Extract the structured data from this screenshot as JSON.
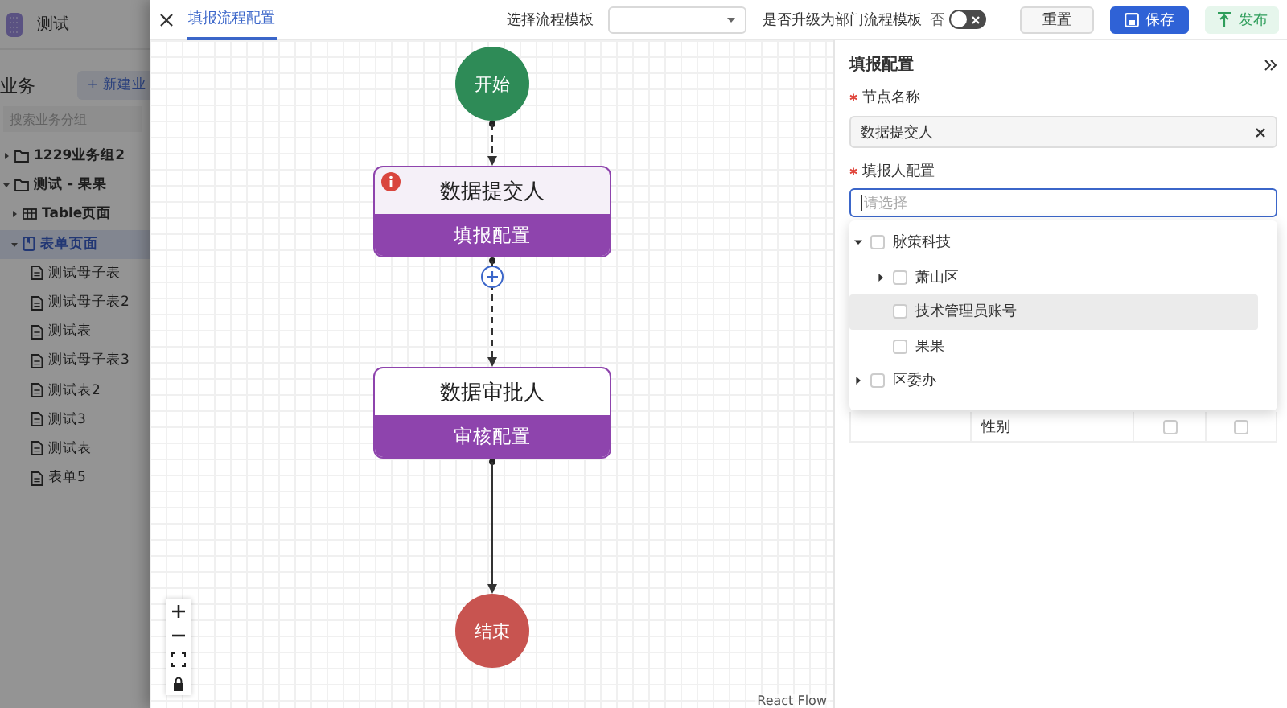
{
  "sidebar": {
    "app_name": "测试",
    "section_title": "业务",
    "new_button": "+ 新建业",
    "search": {
      "placeholder": "搜索业务分组"
    },
    "tree": [
      {
        "label": "1229业务组2",
        "kind": "folder",
        "expanded": false,
        "selected": false
      },
      {
        "label": "测试 - 果果",
        "kind": "folder",
        "expanded": true,
        "selected": false,
        "children": [
          {
            "label": "Table页面",
            "kind": "table",
            "expanded": false,
            "selected": false
          },
          {
            "label": "表单页面",
            "kind": "form",
            "expanded": true,
            "selected": true,
            "children": [
              {
                "label": "测试母子表",
                "kind": "doc",
                "selected": false
              },
              {
                "label": "测试母子表2",
                "kind": "doc",
                "selected": false
              },
              {
                "label": "测试表",
                "kind": "doc",
                "selected": false
              },
              {
                "label": "测试母子表3",
                "kind": "doc",
                "selected": false
              },
              {
                "label": "测试表2",
                "kind": "doc",
                "selected": false
              },
              {
                "label": "测试3",
                "kind": "doc",
                "selected": false
              },
              {
                "label": "测试表",
                "kind": "doc",
                "selected": false
              },
              {
                "label": "表单5",
                "kind": "doc",
                "selected": false
              }
            ]
          }
        ]
      }
    ]
  },
  "topbar": {
    "tabs": [
      {
        "label": "填报流程配置",
        "selected": true
      }
    ],
    "template": {
      "label": "选择流程模板"
    },
    "upgrade": {
      "label": "是否升级为部门流程模板",
      "state_text": "否",
      "on": false
    },
    "buttons": [
      {
        "label": "重置",
        "kind": "default"
      },
      {
        "label": "保存",
        "kind": "primary"
      },
      {
        "label": "发布",
        "kind": "publish"
      }
    ]
  },
  "flow": {
    "nodes": [
      {
        "kind": "start",
        "label": "开始"
      },
      {
        "kind": "task",
        "title": "数据提交人",
        "action": "填报配置",
        "warning": true
      },
      {
        "kind": "task",
        "title": "数据审批人",
        "action": "审核配置",
        "warning": false
      },
      {
        "kind": "end",
        "label": "结束"
      }
    ],
    "edges": [
      {
        "kind": "dashed",
        "add_button": false
      },
      {
        "kind": "dashed",
        "add_button": true
      },
      {
        "kind": "solid",
        "add_button": false
      }
    ],
    "attribution": "React Flow"
  },
  "panel": {
    "title": "填报配置",
    "fields": [
      {
        "label": "节点名称",
        "required": true,
        "kind": "text",
        "value": "数据提交人",
        "focused": false
      },
      {
        "label": "填报人配置",
        "required": true,
        "kind": "select",
        "placeholder": "请选择",
        "focused": true
      }
    ],
    "dropdown": [
      {
        "label": "脉策科技",
        "expandable": true,
        "expanded": true,
        "checked": false,
        "hovered": false,
        "children": [
          {
            "label": "萧山区",
            "expandable": true,
            "expanded": false,
            "checked": false,
            "hovered": false
          },
          {
            "label": "技术管理员账号",
            "expandable": false,
            "checked": false,
            "hovered": true
          },
          {
            "label": "果果",
            "expandable": false,
            "checked": false,
            "hovered": false
          }
        ]
      },
      {
        "label": "区委办",
        "expandable": true,
        "expanded": false,
        "checked": false,
        "hovered": false
      }
    ],
    "table_rows": [
      {
        "label": "性别",
        "checks": [
          false,
          false
        ]
      }
    ]
  }
}
